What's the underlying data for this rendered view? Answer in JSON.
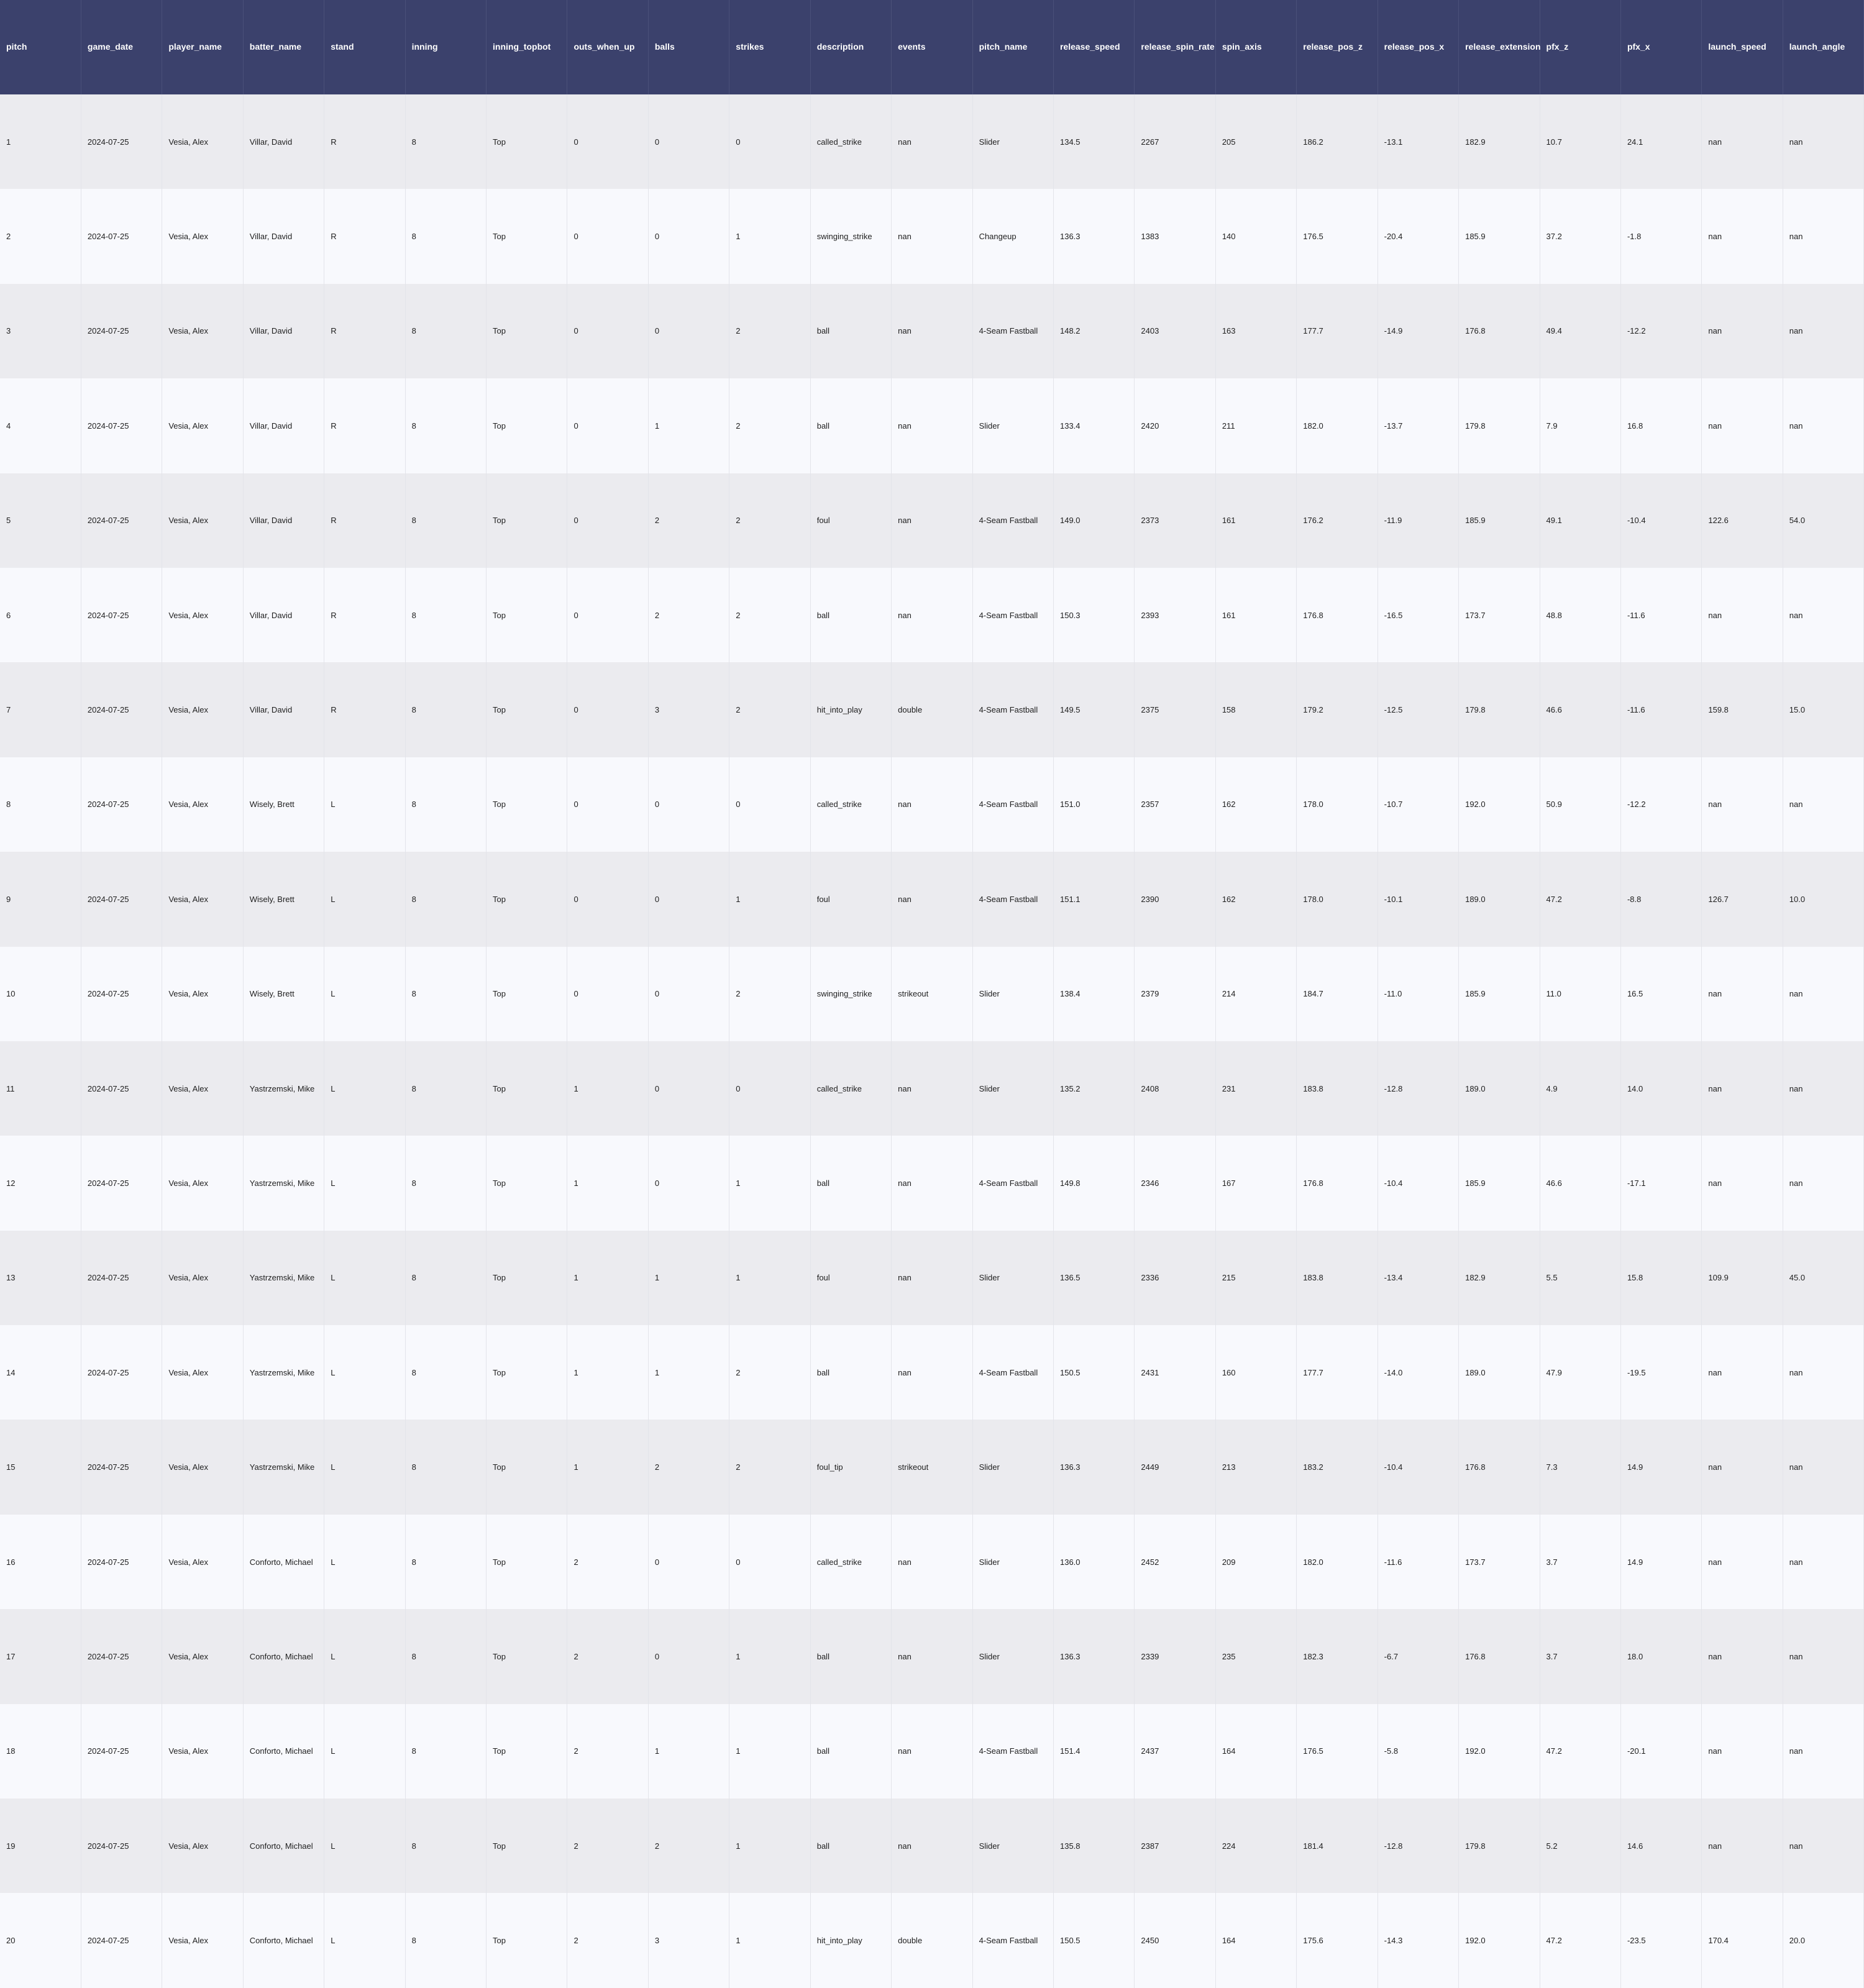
{
  "chart_data": {
    "type": "table",
    "columns": [
      "pitch",
      "game_date",
      "player_name",
      "batter_name",
      "stand",
      "inning",
      "inning_topbot",
      "outs_when_up",
      "balls",
      "strikes",
      "description",
      "events",
      "pitch_name",
      "release_speed",
      "release_spin_rate",
      "spin_axis",
      "release_pos_z",
      "release_pos_x",
      "release_extension",
      "pfx_z",
      "pfx_x",
      "launch_speed",
      "launch_angle"
    ],
    "rows": [
      [
        "1",
        "2024-07-25",
        "Vesia, Alex",
        "Villar, David",
        "R",
        "8",
        "Top",
        "0",
        "0",
        "0",
        "called_strike",
        "nan",
        "Slider",
        "134.5",
        "2267",
        "205",
        "186.2",
        "-13.1",
        "182.9",
        "10.7",
        "24.1",
        "nan",
        "nan"
      ],
      [
        "2",
        "2024-07-25",
        "Vesia, Alex",
        "Villar, David",
        "R",
        "8",
        "Top",
        "0",
        "0",
        "1",
        "swinging_strike",
        "nan",
        "Changeup",
        "136.3",
        "1383",
        "140",
        "176.5",
        "-20.4",
        "185.9",
        "37.2",
        "-1.8",
        "nan",
        "nan"
      ],
      [
        "3",
        "2024-07-25",
        "Vesia, Alex",
        "Villar, David",
        "R",
        "8",
        "Top",
        "0",
        "0",
        "2",
        "ball",
        "nan",
        "4-Seam Fastball",
        "148.2",
        "2403",
        "163",
        "177.7",
        "-14.9",
        "176.8",
        "49.4",
        "-12.2",
        "nan",
        "nan"
      ],
      [
        "4",
        "2024-07-25",
        "Vesia, Alex",
        "Villar, David",
        "R",
        "8",
        "Top",
        "0",
        "1",
        "2",
        "ball",
        "nan",
        "Slider",
        "133.4",
        "2420",
        "211",
        "182.0",
        "-13.7",
        "179.8",
        "7.9",
        "16.8",
        "nan",
        "nan"
      ],
      [
        "5",
        "2024-07-25",
        "Vesia, Alex",
        "Villar, David",
        "R",
        "8",
        "Top",
        "0",
        "2",
        "2",
        "foul",
        "nan",
        "4-Seam Fastball",
        "149.0",
        "2373",
        "161",
        "176.2",
        "-11.9",
        "185.9",
        "49.1",
        "-10.4",
        "122.6",
        "54.0"
      ],
      [
        "6",
        "2024-07-25",
        "Vesia, Alex",
        "Villar, David",
        "R",
        "8",
        "Top",
        "0",
        "2",
        "2",
        "ball",
        "nan",
        "4-Seam Fastball",
        "150.3",
        "2393",
        "161",
        "176.8",
        "-16.5",
        "173.7",
        "48.8",
        "-11.6",
        "nan",
        "nan"
      ],
      [
        "7",
        "2024-07-25",
        "Vesia, Alex",
        "Villar, David",
        "R",
        "8",
        "Top",
        "0",
        "3",
        "2",
        "hit_into_play",
        "double",
        "4-Seam Fastball",
        "149.5",
        "2375",
        "158",
        "179.2",
        "-12.5",
        "179.8",
        "46.6",
        "-11.6",
        "159.8",
        "15.0"
      ],
      [
        "8",
        "2024-07-25",
        "Vesia, Alex",
        "Wisely, Brett",
        "L",
        "8",
        "Top",
        "0",
        "0",
        "0",
        "called_strike",
        "nan",
        "4-Seam Fastball",
        "151.0",
        "2357",
        "162",
        "178.0",
        "-10.7",
        "192.0",
        "50.9",
        "-12.2",
        "nan",
        "nan"
      ],
      [
        "9",
        "2024-07-25",
        "Vesia, Alex",
        "Wisely, Brett",
        "L",
        "8",
        "Top",
        "0",
        "0",
        "1",
        "foul",
        "nan",
        "4-Seam Fastball",
        "151.1",
        "2390",
        "162",
        "178.0",
        "-10.1",
        "189.0",
        "47.2",
        "-8.8",
        "126.7",
        "10.0"
      ],
      [
        "10",
        "2024-07-25",
        "Vesia, Alex",
        "Wisely, Brett",
        "L",
        "8",
        "Top",
        "0",
        "0",
        "2",
        "swinging_strike",
        "strikeout",
        "Slider",
        "138.4",
        "2379",
        "214",
        "184.7",
        "-11.0",
        "185.9",
        "11.0",
        "16.5",
        "nan",
        "nan"
      ],
      [
        "11",
        "2024-07-25",
        "Vesia, Alex",
        "Yastrzemski, Mike",
        "L",
        "8",
        "Top",
        "1",
        "0",
        "0",
        "called_strike",
        "nan",
        "Slider",
        "135.2",
        "2408",
        "231",
        "183.8",
        "-12.8",
        "189.0",
        "4.9",
        "14.0",
        "nan",
        "nan"
      ],
      [
        "12",
        "2024-07-25",
        "Vesia, Alex",
        "Yastrzemski, Mike",
        "L",
        "8",
        "Top",
        "1",
        "0",
        "1",
        "ball",
        "nan",
        "4-Seam Fastball",
        "149.8",
        "2346",
        "167",
        "176.8",
        "-10.4",
        "185.9",
        "46.6",
        "-17.1",
        "nan",
        "nan"
      ],
      [
        "13",
        "2024-07-25",
        "Vesia, Alex",
        "Yastrzemski, Mike",
        "L",
        "8",
        "Top",
        "1",
        "1",
        "1",
        "foul",
        "nan",
        "Slider",
        "136.5",
        "2336",
        "215",
        "183.8",
        "-13.4",
        "182.9",
        "5.5",
        "15.8",
        "109.9",
        "45.0"
      ],
      [
        "14",
        "2024-07-25",
        "Vesia, Alex",
        "Yastrzemski, Mike",
        "L",
        "8",
        "Top",
        "1",
        "1",
        "2",
        "ball",
        "nan",
        "4-Seam Fastball",
        "150.5",
        "2431",
        "160",
        "177.7",
        "-14.0",
        "189.0",
        "47.9",
        "-19.5",
        "nan",
        "nan"
      ],
      [
        "15",
        "2024-07-25",
        "Vesia, Alex",
        "Yastrzemski, Mike",
        "L",
        "8",
        "Top",
        "1",
        "2",
        "2",
        "foul_tip",
        "strikeout",
        "Slider",
        "136.3",
        "2449",
        "213",
        "183.2",
        "-10.4",
        "176.8",
        "7.3",
        "14.9",
        "nan",
        "nan"
      ],
      [
        "16",
        "2024-07-25",
        "Vesia, Alex",
        "Conforto, Michael",
        "L",
        "8",
        "Top",
        "2",
        "0",
        "0",
        "called_strike",
        "nan",
        "Slider",
        "136.0",
        "2452",
        "209",
        "182.0",
        "-11.6",
        "173.7",
        "3.7",
        "14.9",
        "nan",
        "nan"
      ],
      [
        "17",
        "2024-07-25",
        "Vesia, Alex",
        "Conforto, Michael",
        "L",
        "8",
        "Top",
        "2",
        "0",
        "1",
        "ball",
        "nan",
        "Slider",
        "136.3",
        "2339",
        "235",
        "182.3",
        "-6.7",
        "176.8",
        "3.7",
        "18.0",
        "nan",
        "nan"
      ],
      [
        "18",
        "2024-07-25",
        "Vesia, Alex",
        "Conforto, Michael",
        "L",
        "8",
        "Top",
        "2",
        "1",
        "1",
        "ball",
        "nan",
        "4-Seam Fastball",
        "151.4",
        "2437",
        "164",
        "176.5",
        "-5.8",
        "192.0",
        "47.2",
        "-20.1",
        "nan",
        "nan"
      ],
      [
        "19",
        "2024-07-25",
        "Vesia, Alex",
        "Conforto, Michael",
        "L",
        "8",
        "Top",
        "2",
        "2",
        "1",
        "ball",
        "nan",
        "Slider",
        "135.8",
        "2387",
        "224",
        "181.4",
        "-12.8",
        "179.8",
        "5.2",
        "14.6",
        "nan",
        "nan"
      ],
      [
        "20",
        "2024-07-25",
        "Vesia, Alex",
        "Conforto, Michael",
        "L",
        "8",
        "Top",
        "2",
        "3",
        "1",
        "hit_into_play",
        "double",
        "4-Seam Fastball",
        "150.5",
        "2450",
        "164",
        "175.6",
        "-14.3",
        "192.0",
        "47.2",
        "-23.5",
        "170.4",
        "20.0"
      ]
    ]
  },
  "colors": {
    "header_bg": "#3b416c",
    "header_text": "#ffffff",
    "row_odd": "#ebebef",
    "row_even": "#f8f9fd",
    "cell_text": "#1e1e1e"
  }
}
